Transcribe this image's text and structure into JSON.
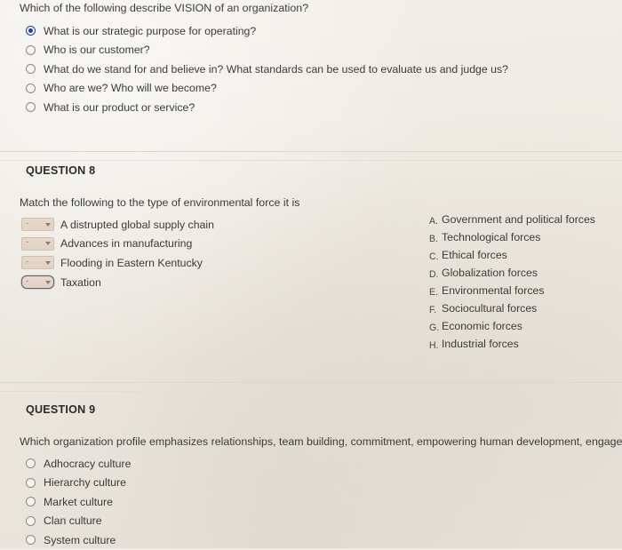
{
  "question7": {
    "stem": "Which of the following describe VISION of an organization?",
    "options": [
      {
        "label": "What is our strategic purpose for operating?",
        "selected": true
      },
      {
        "label": "Who is our customer?",
        "selected": false
      },
      {
        "label": "What do we stand for and believe in? What standards can be used to evaluate us and judge us?",
        "selected": false
      },
      {
        "label": "Who are we? Who will we become?",
        "selected": false
      },
      {
        "label": "What is our product or service?",
        "selected": false
      }
    ]
  },
  "question8": {
    "heading": "QUESTION 8",
    "stem": "Match the following to the type of environmental force it is",
    "items": [
      {
        "value": "-",
        "label": "A distrupted global supply chain",
        "focused": false
      },
      {
        "value": "-",
        "label": "Advances in manufacturing",
        "focused": false
      },
      {
        "value": "-",
        "label": "Flooding in Eastern Kentucky",
        "focused": false
      },
      {
        "value": "-",
        "label": "Taxation",
        "focused": true
      }
    ],
    "key": [
      {
        "letter": "A.",
        "text": "Government and political forces"
      },
      {
        "letter": "B.",
        "text": "Technological forces"
      },
      {
        "letter": "C.",
        "text": "Ethical forces"
      },
      {
        "letter": "D.",
        "text": "Globalization forces"
      },
      {
        "letter": "E.",
        "text": "Environmental forces"
      },
      {
        "letter": "F.",
        "text": "Sociocultural forces"
      },
      {
        "letter": "G.",
        "text": "Economic forces"
      },
      {
        "letter": "H.",
        "text": "Industrial forces"
      }
    ]
  },
  "question9": {
    "heading": "QUESTION 9",
    "stem": "Which organization profile emphasizes relationships, team building, commitment, empowering human development, engagement,",
    "options": [
      {
        "label": "Adhocracy culture",
        "selected": false
      },
      {
        "label": "Hierarchy culture",
        "selected": false
      },
      {
        "label": "Market culture",
        "selected": false
      },
      {
        "label": "Clan culture",
        "selected": false
      },
      {
        "label": "System culture",
        "selected": false
      }
    ]
  },
  "colors": {
    "page_background": "#efebe4",
    "text": "#3b3b39",
    "radio_selected": "#1f3f9e",
    "dropdown_background": "#e4d5c7",
    "focus_border": "#5b6374",
    "rule": "#dcd7cd"
  }
}
